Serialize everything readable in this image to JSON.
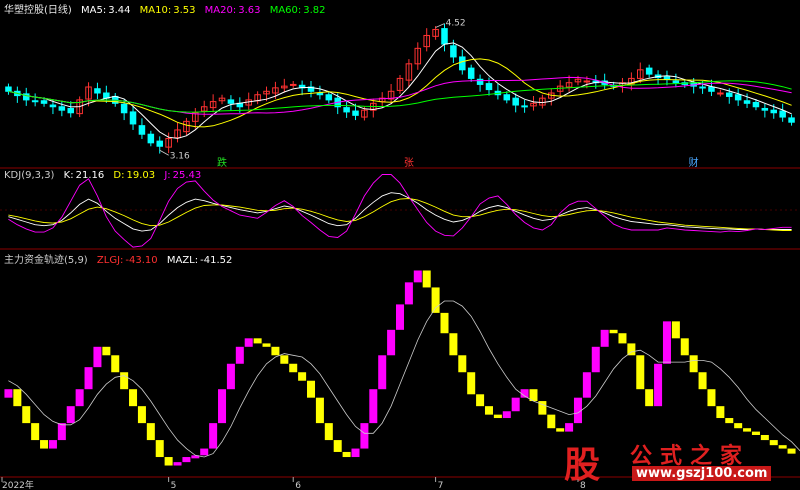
{
  "header_main": {
    "stock_name": "华塑控股(日线)",
    "ma5": {
      "label": "MA5:",
      "value": "3.44",
      "color": "#ffffff"
    },
    "ma10": {
      "label": "MA10:",
      "value": "3.53",
      "color": "#ffff00"
    },
    "ma20": {
      "label": "MA20:",
      "value": "3.63",
      "color": "#ff00ff"
    },
    "ma60": {
      "label": "MA60:",
      "value": "3.82",
      "color": "#00ff00"
    }
  },
  "header_kdj": {
    "name": "KDJ(9,3,3)",
    "k": {
      "label": "K:",
      "value": "21.16",
      "color": "#ffffff"
    },
    "d": {
      "label": "D:",
      "value": "19.03",
      "color": "#ffff00"
    },
    "j": {
      "label": "J:",
      "value": "25.43",
      "color": "#ff00ff"
    }
  },
  "header_zlgj": {
    "name": "主力资金轨迹(5,9)",
    "zlgj": {
      "label": "ZLGJ:",
      "value": "-43.10",
      "color": "#ff3030"
    },
    "mazl": {
      "label": "MAZL:",
      "value": "-41.52",
      "color": "#ffffff"
    }
  },
  "annotations": {
    "high": "4.52",
    "low": "3.16"
  },
  "markers": [
    {
      "label": "跌",
      "color": "#22dd22",
      "index": 24
    },
    {
      "label": "张",
      "color": "#ff3030",
      "index": 45
    },
    {
      "label": "财",
      "color": "#4aa8ff",
      "index": 77
    }
  ],
  "x_axis": [
    {
      "label": "2022年",
      "index": 0
    },
    {
      "label": "5",
      "index": 18
    },
    {
      "label": "6",
      "index": 32
    },
    {
      "label": "7",
      "index": 48
    },
    {
      "label": "8",
      "index": 64
    }
  ],
  "watermark": {
    "logo": "股",
    "title": "公式之家",
    "url": "www.gszj100.com"
  },
  "colors": {
    "up": "#ff3232",
    "down": "#00ffff",
    "grid": "#8b0000",
    "zl_up": "#ff00ff",
    "zl_down": "#ffff00",
    "ma60": "#00ff00"
  },
  "chart_data": [
    {
      "type": "candlestick",
      "title": "华塑控股(日线)",
      "ylim": [
        3.0,
        4.7
      ],
      "closes": [
        3.8,
        3.75,
        3.7,
        3.68,
        3.66,
        3.62,
        3.58,
        3.55,
        3.7,
        3.85,
        3.78,
        3.72,
        3.66,
        3.55,
        3.42,
        3.3,
        3.2,
        3.16,
        3.25,
        3.35,
        3.45,
        3.55,
        3.62,
        3.68,
        3.72,
        3.66,
        3.62,
        3.7,
        3.76,
        3.8,
        3.84,
        3.86,
        3.88,
        3.84,
        3.8,
        3.76,
        3.7,
        3.62,
        3.56,
        3.52,
        3.58,
        3.66,
        3.72,
        3.8,
        3.95,
        4.12,
        4.3,
        4.45,
        4.52,
        4.35,
        4.2,
        4.05,
        3.95,
        3.88,
        3.82,
        3.76,
        3.7,
        3.64,
        3.62,
        3.66,
        3.72,
        3.78,
        3.86,
        3.9,
        3.94,
        3.92,
        3.9,
        3.88,
        3.86,
        3.9,
        3.95,
        4.05,
        4.0,
        3.96,
        3.94,
        3.9,
        3.88,
        3.86,
        3.84,
        3.8,
        3.78,
        3.74,
        3.7,
        3.66,
        3.62,
        3.58,
        3.55,
        3.5,
        3.44
      ],
      "series": [
        {
          "name": "MA5",
          "value": 3.44
        },
        {
          "name": "MA10",
          "value": 3.53
        },
        {
          "name": "MA20",
          "value": 3.63
        },
        {
          "name": "MA60",
          "value": 3.82
        }
      ]
    },
    {
      "type": "line",
      "title": "KDJ(9,3,3)",
      "ylim": [
        -10,
        110
      ],
      "series": [
        {
          "name": "K",
          "values": [
            45,
            40,
            35,
            30,
            28,
            30,
            38,
            52,
            68,
            78,
            70,
            55,
            42,
            32,
            22,
            18,
            20,
            32,
            48,
            62,
            72,
            78,
            75,
            70,
            66,
            62,
            58,
            55,
            52,
            55,
            60,
            65,
            62,
            55,
            48,
            40,
            32,
            28,
            30,
            42,
            58,
            72,
            84,
            90,
            88,
            80,
            70,
            58,
            48,
            40,
            35,
            38,
            45,
            55,
            62,
            66,
            62,
            55,
            48,
            42,
            38,
            40,
            48,
            55,
            60,
            62,
            58,
            52,
            45,
            40,
            36,
            34,
            32,
            30,
            30,
            28,
            26,
            25,
            24,
            23,
            22,
            22,
            21,
            21,
            22,
            21,
            21,
            21,
            21
          ]
        },
        {
          "name": "D",
          "values": [
            48,
            45,
            41,
            37,
            34,
            33,
            35,
            41,
            50,
            59,
            63,
            60,
            54,
            47,
            39,
            32,
            28,
            29,
            35,
            44,
            53,
            61,
            66,
            67,
            67,
            65,
            63,
            60,
            57,
            56,
            57,
            60,
            61,
            59,
            55,
            50,
            44,
            39,
            36,
            38,
            45,
            54,
            64,
            73,
            78,
            79,
            76,
            70,
            63,
            55,
            48,
            45,
            45,
            48,
            53,
            57,
            59,
            58,
            55,
            51,
            47,
            45,
            46,
            49,
            53,
            56,
            57,
            55,
            52,
            48,
            44,
            41,
            38,
            35,
            33,
            31,
            29,
            28,
            27,
            26,
            25,
            24,
            23,
            22,
            22,
            21,
            20,
            19,
            19
          ]
        },
        {
          "name": "J",
          "values": [
            40,
            30,
            22,
            16,
            16,
            24,
            44,
            74,
            104,
            116,
            84,
            45,
            18,
            2,
            -12,
            -10,
            4,
            38,
            74,
            98,
            110,
            112,
            93,
            76,
            64,
            56,
            48,
            45,
            42,
            53,
            66,
            75,
            64,
            47,
            34,
            20,
            8,
            6,
            18,
            50,
            84,
            108,
            124,
            124,
            108,
            82,
            58,
            34,
            18,
            10,
            9,
            24,
            45,
            69,
            80,
            84,
            68,
            49,
            34,
            24,
            20,
            30,
            52,
            67,
            74,
            74,
            60,
            46,
            31,
            24,
            20,
            20,
            20,
            20,
            24,
            22,
            20,
            19,
            18,
            17,
            16,
            18,
            17,
            19,
            22,
            21,
            23,
            25,
            25
          ]
        }
      ]
    },
    {
      "type": "bar",
      "title": "主力资金轨迹(5,9)",
      "ylim": [
        -55,
        70
      ],
      "series": [
        {
          "name": "ZLGJ",
          "values": [
            -5,
            -15,
            -25,
            -35,
            -40,
            -35,
            -25,
            -15,
            -5,
            8,
            20,
            15,
            5,
            -5,
            -15,
            -25,
            -35,
            -45,
            -50,
            -48,
            -45,
            -44,
            -40,
            -25,
            -5,
            10,
            20,
            25,
            22,
            20,
            15,
            10,
            5,
            0,
            -10,
            -25,
            -35,
            -42,
            -45,
            -40,
            -25,
            -5,
            15,
            30,
            45,
            58,
            65,
            55,
            40,
            28,
            15,
            5,
            -8,
            -15,
            -20,
            -22,
            -18,
            -10,
            -5,
            -12,
            -20,
            -28,
            -30,
            -25,
            -10,
            5,
            20,
            30,
            28,
            22,
            15,
            -5,
            -15,
            10,
            35,
            25,
            15,
            5,
            -5,
            -15,
            -22,
            -25,
            -28,
            -30,
            -32,
            -35,
            -38,
            -40,
            -43
          ]
        },
        {
          "name": "MAZL",
          "values": [
            0,
            -3,
            -8,
            -14,
            -20,
            -24,
            -26,
            -26,
            -23,
            -16,
            -8,
            -2,
            2,
            3,
            0,
            -5,
            -12,
            -20,
            -28,
            -35,
            -40,
            -44,
            -45,
            -43,
            -36,
            -27,
            -16,
            -6,
            3,
            10,
            14,
            16,
            15,
            14,
            10,
            4,
            -4,
            -12,
            -20,
            -27,
            -31,
            -31,
            -25,
            -15,
            -2,
            11,
            24,
            35,
            43,
            47,
            47,
            44,
            38,
            29,
            19,
            10,
            2,
            -5,
            -9,
            -12,
            -14,
            -16,
            -18,
            -20,
            -19,
            -15,
            -9,
            -1,
            7,
            13,
            17,
            18,
            15,
            11,
            11,
            11,
            11,
            12,
            12,
            11,
            7,
            2,
            -4,
            -11,
            -17,
            -22,
            -27,
            -32,
            -36,
            -41.52
          ]
        }
      ]
    }
  ]
}
